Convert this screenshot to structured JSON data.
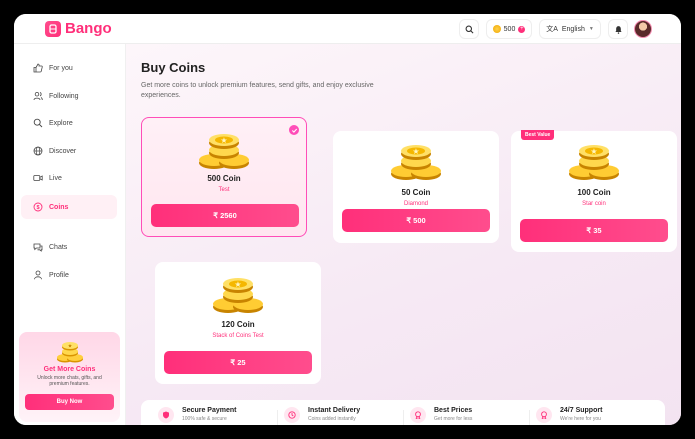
{
  "app": {
    "name": "Bango"
  },
  "header": {
    "coin_balance": "500",
    "language": "English"
  },
  "sidebar": {
    "items": [
      {
        "label": "For you",
        "icon": "thumbs-up-icon"
      },
      {
        "label": "Following",
        "icon": "users-icon"
      },
      {
        "label": "Explore",
        "icon": "search-icon"
      },
      {
        "label": "Discover",
        "icon": "globe-icon"
      },
      {
        "label": "Live",
        "icon": "video-icon"
      },
      {
        "label": "Coins",
        "icon": "coin-icon",
        "active": true
      },
      {
        "label": "Chats",
        "icon": "chat-icon"
      },
      {
        "label": "Profile",
        "icon": "user-icon"
      }
    ],
    "promo": {
      "title": "Get More Coins",
      "subtitle": "Unlock more chats, gifts, and premium features.",
      "button": "Buy Now"
    }
  },
  "main": {
    "title": "Buy Coins",
    "subtitle": "Get more coins to unlock premium features, send gifts, and enjoy exclusive experiences.",
    "packages": [
      {
        "title": "500 Coin",
        "subtitle": "Test",
        "price": "₹ 2560",
        "selected": true
      },
      {
        "title": "50 Coin",
        "subtitle": "Diamond",
        "price": "₹ 500"
      },
      {
        "title": "100 Coin",
        "subtitle": "Star coin",
        "price": "₹ 35",
        "badge": "Best Value"
      },
      {
        "title": "120 Coin",
        "subtitle": "Stack of Coins Test",
        "price": "₹ 25"
      }
    ],
    "features": [
      {
        "title": "Secure Payment",
        "subtitle": "100% safe & secure"
      },
      {
        "title": "Instant Delivery",
        "subtitle": "Coins added instantly"
      },
      {
        "title": "Best Prices",
        "subtitle": "Get more for less"
      },
      {
        "title": "24/7 Support",
        "subtitle": "We're here for you"
      }
    ]
  },
  "colors": {
    "accent": "#ff2f7a",
    "selected_border": "#ff4db8"
  }
}
